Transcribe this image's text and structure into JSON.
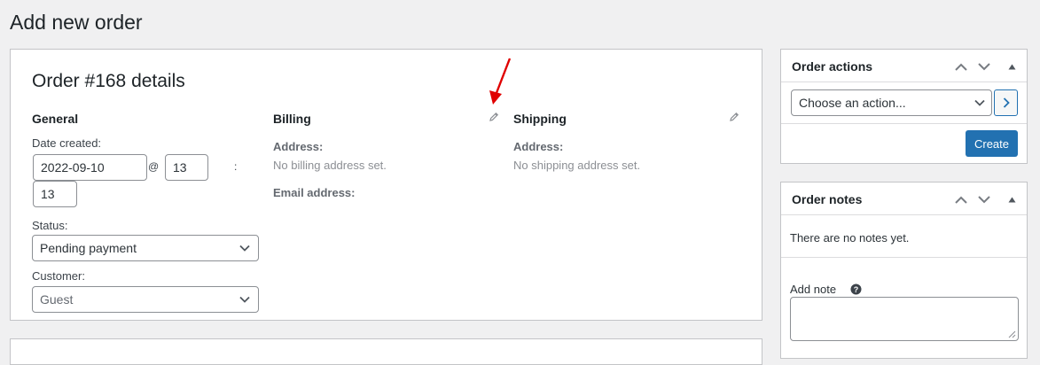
{
  "page": {
    "title": "Add new order"
  },
  "order": {
    "heading": "Order #168 details",
    "general": {
      "heading": "General",
      "date_label": "Date created:",
      "date_value": "2022-09-10",
      "at_sep": "@",
      "hour_value": "13",
      "colon_sep": ":",
      "minute_value": "13",
      "status_label": "Status:",
      "status_value": "Pending payment",
      "customer_label": "Customer:",
      "customer_value": "Guest"
    },
    "billing": {
      "heading": "Billing",
      "address_label": "Address:",
      "address_value": "No billing address set.",
      "email_label": "Email address:"
    },
    "shipping": {
      "heading": "Shipping",
      "address_label": "Address:",
      "address_value": "No shipping address set."
    }
  },
  "order_actions": {
    "title": "Order actions",
    "select_value": "Choose an action...",
    "create_label": "Create"
  },
  "order_notes": {
    "title": "Order notes",
    "empty_text": "There are no notes yet.",
    "add_note_label": "Add note"
  },
  "icons": {
    "pencil": "pencil-icon",
    "chevron_up": "chevron-up-icon",
    "chevron_down": "chevron-down-icon",
    "triangle_up": "triangle-up-icon",
    "help": "help-icon",
    "arrow_right": "chevron-right-icon"
  },
  "colors": {
    "primary": "#2271b1",
    "background": "#f0f0f1",
    "annotation_arrow": "#e00000"
  }
}
